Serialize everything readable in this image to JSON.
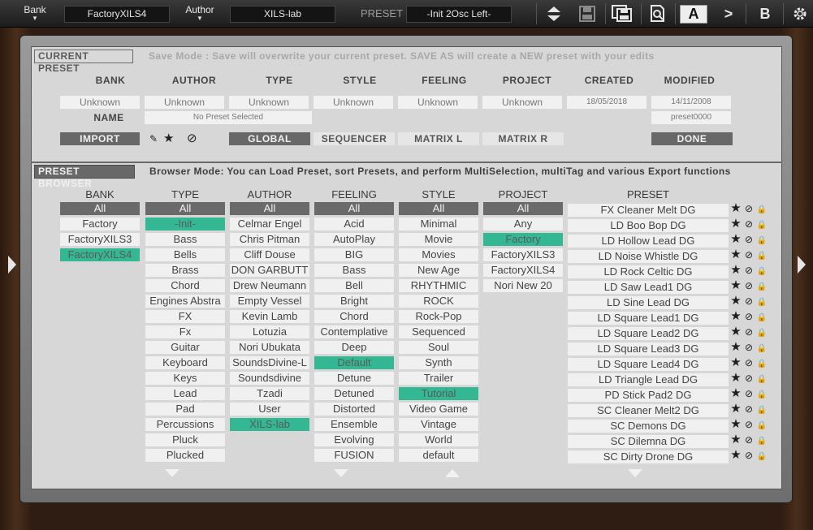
{
  "topbar": {
    "bank_label": "Bank",
    "bank_value": "FactoryXILS4",
    "author_label": "Author",
    "author_value": "XILS-lab",
    "preset_label": "PRESET",
    "preset_value": "-Init 2Osc Left-",
    "btn_a": "A",
    "btn_next": ">",
    "btn_b": "B",
    "dropdown_arrow": "▼",
    "icons": [
      "up-down-arrows-icon",
      "save-icon",
      "save-as-icon",
      "search-document-icon",
      "gear-icon"
    ]
  },
  "current_preset": {
    "title": "CURRENT PRESET",
    "note": "Save Mode : Save will overwrite your current preset. SAVE AS will create a NEW preset with your edits",
    "headers": {
      "bank": "BANK",
      "author": "AUTHOR",
      "type": "TYPE",
      "style": "STYLE",
      "feeling": "FEELING",
      "project": "PROJECT",
      "created": "CREATED",
      "modified": "MODIFIED"
    },
    "values": {
      "bank": "Unknown",
      "author": "Unknown",
      "type": "Unknown",
      "style": "Unknown",
      "feeling": "Unknown",
      "project": "Unknown",
      "created": "18/05/2018",
      "modified": "14/11/2008"
    },
    "name_label": "NAME",
    "name_value": "No Preset Selected",
    "preset_id": "preset0000",
    "buttons": {
      "import": "IMPORT",
      "global": "GLOBAL",
      "sequencer": "SEQUENCER",
      "matrix_l": "MATRIX L",
      "matrix_r": "MATRIX R",
      "done": "DONE"
    },
    "icon_glyphs": {
      "pen": "✎",
      "star": "★",
      "ban": "⊘"
    }
  },
  "browser": {
    "title": "PRESET BROWSER",
    "note": "Browser Mode: You can Load Preset, sort Presets, and perform MultiSelection, multiTag and various Export functions",
    "columns": {
      "bank": {
        "header": "BANK",
        "items": [
          "All",
          "Factory",
          "FactoryXILS3",
          "FactoryXILS4"
        ],
        "selected": 3
      },
      "type": {
        "header": "TYPE",
        "items": [
          "All",
          "-Init-",
          "Bass",
          "Bells",
          "Brass",
          "Chord",
          "Engines Abstra",
          "FX",
          "Fx",
          "Guitar",
          "Keyboard",
          "Keys",
          "Lead",
          "Pad",
          "Percussions",
          "Pluck",
          "Plucked"
        ],
        "selected": 1
      },
      "author": {
        "header": "AUTHOR",
        "items": [
          "All",
          "Celmar Engel",
          "Chris Pitman",
          "Cliff Douse",
          "DON GARBUTT",
          "Drew Neumann",
          "Empty Vessel",
          "Kevin Lamb",
          "Lotuzia",
          "Nori Ubukata",
          "SoundsDivine-L",
          "Soundsdivine",
          "Tzadi",
          "User",
          "XILS-lab"
        ],
        "selected": 14
      },
      "feeling": {
        "header": "FEELING",
        "items": [
          "All",
          "Acid",
          "AutoPlay",
          "BIG",
          "Bass",
          "Bell",
          "Bright",
          "Chord",
          "Contemplative",
          "Deep",
          "Default",
          "Detune",
          "Detuned",
          "Distorted",
          "Ensemble",
          "Evolving",
          "FUSION"
        ],
        "selected": 10
      },
      "style": {
        "header": "STYLE",
        "items": [
          "All",
          "Minimal",
          "Movie",
          "Movies",
          "New Age",
          "RHYTHMIC",
          "ROCK",
          "Rock-Pop",
          "Sequenced",
          "Soul",
          "Synth",
          "Trailer",
          "Tutorial",
          "Video Game",
          "Vintage",
          "World",
          "default"
        ],
        "selected": 12
      },
      "project": {
        "header": "PROJECT",
        "items": [
          "All",
          "Any",
          "Factory",
          "FactoryXILS3",
          "FactoryXILS4",
          "Nori New 20"
        ],
        "selected": 2
      },
      "preset": {
        "header": "PRESET",
        "items": [
          "FX Cleaner Melt DG",
          "LD Boo Bop DG",
          "LD Hollow Lead DG",
          "LD Noise Whistle DG",
          "LD Rock Celtic DG",
          "LD Saw Lead1 DG",
          "LD Sine Lead DG",
          "LD Square Lead1 DG",
          "LD Square Lead2 DG",
          "LD Square Lead3 DG",
          "LD Square Lead4 DG",
          "LD Triangle Lead DG",
          "PD Stick Pad2 DG",
          "SC Cleaner Melt2 DG",
          "SC Demons DG",
          "SC Dilemna DG",
          "SC Dirty Drone DG"
        ]
      }
    },
    "row_icon_glyphs": {
      "star": "★",
      "ban": "⊘",
      "lock": "🔒"
    }
  },
  "colors": {
    "selected": "#34b894",
    "all_bg": "#6a6a6a",
    "panel_bg": "#d7d7d7",
    "topbar_bg": "#1c1c1c",
    "wood": "#3a2418"
  }
}
